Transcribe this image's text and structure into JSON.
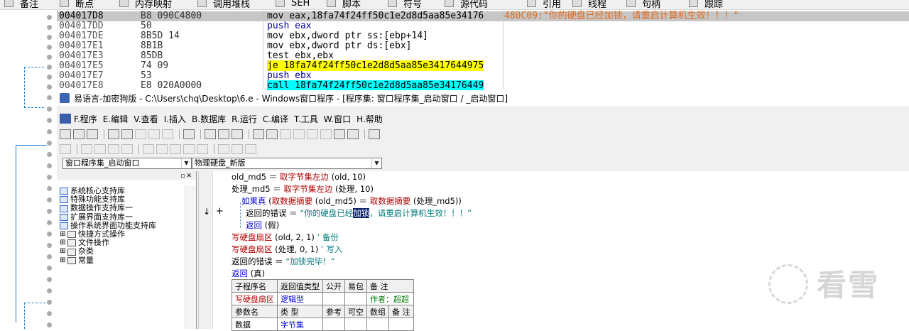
{
  "toolbar": {
    "items": [
      "备注",
      "断点",
      "内存映射",
      "调用堆栈",
      "SEH",
      "脚本",
      "符号",
      "源代码",
      "引用",
      "线程",
      "句柄",
      "跟踪"
    ]
  },
  "disasm": {
    "rows": [
      {
        "addr": "004017D8",
        "bytes": "B8 090C4800",
        "instr": "mov eax,18fa74f24ff50c1e2d8d5aa85e34176",
        "comment": "480C09:\"你的硬盘已经加锁，请重启计算机生效！！！\""
      },
      {
        "addr": "004017DD",
        "bytes": "50",
        "instr": "push eax",
        "comment": ""
      },
      {
        "addr": "004017DE",
        "bytes": "8B5D 14",
        "instr": "mov ebx,dword ptr ss:[ebp+14]",
        "comment": ""
      },
      {
        "addr": "004017E1",
        "bytes": "8B1B",
        "instr": "mov ebx,dword ptr ds:[ebx]",
        "comment": ""
      },
      {
        "addr": "004017E3",
        "bytes": "85DB",
        "instr": "test ebx,ebx",
        "comment": ""
      },
      {
        "addr": "004017E5",
        "bytes": "74 09",
        "instr": "je 18fa74f24ff50c1e2d8d5aa85e3417644975",
        "comment": ""
      },
      {
        "addr": "004017E7",
        "bytes": "53",
        "instr": "push ebx",
        "comment": ""
      },
      {
        "addr": "004017E8",
        "bytes": "E8 020A0000",
        "instr": "call 18fa74f24ff50c1e2d8d5aa85e34176449",
        "comment": ""
      }
    ]
  },
  "window": {
    "title": "易语言-加密狗版 - C:\\Users\\chq\\Desktop\\6.e - Windows窗口程序 - [程序集: 窗口程序集_启动窗口 / _启动窗口]"
  },
  "menu": {
    "items": [
      "F.程序",
      "E.编辑",
      "V.查看",
      "I.插入",
      "B.数据库",
      "R.运行",
      "C.编译",
      "T.工具",
      "W.窗口",
      "H.帮助"
    ]
  },
  "combos": {
    "assembly": "窗口程序集_启动窗口",
    "subroutine": "物理硬盘_新版"
  },
  "tree": [
    {
      "label": "系统核心支持库",
      "kind": "book"
    },
    {
      "label": "特殊功能支持库",
      "kind": "book"
    },
    {
      "label": "数据操作支持库一",
      "kind": "book"
    },
    {
      "label": "扩展界面支持库一",
      "kind": "book"
    },
    {
      "label": "操作系统界面功能支持库",
      "kind": "book"
    },
    {
      "label": "快捷方式操作",
      "kind": "plus"
    },
    {
      "label": "文件操作",
      "kind": "plus"
    },
    {
      "label": "杂类",
      "kind": "plus"
    },
    {
      "label": "常量",
      "kind": "plus"
    }
  ],
  "code": {
    "l1a": "old_md5 ＝ ",
    "l1b": "取字节集左边",
    "l1c": " (old, 10)",
    "l2a": "处理_md5 ＝ ",
    "l2b": "取字节集左边",
    "l2c": " (处理, 10)",
    "l3a": "如果真",
    "l3b": " (",
    "l3c": "取数据摘要",
    "l3d": " (old_md5) ＝ ",
    "l3e": "取数据摘要",
    "l3f": " (处理_md5))",
    "l4a": "返回的错误 ＝ ",
    "l4b": "“你的硬盘已经",
    "l4c": "加锁",
    "l4d": "，请重启计算机生效！！！”",
    "l5a": "返回",
    "l5b": " (假)",
    "l6a": "写硬盘扇区",
    "l6b": " (old, 2, 1) ",
    "l6c": "’ 备份",
    "l7a": "写硬盘扇区",
    "l7b": " (处理, 0, 1) ",
    "l7c": "’ 写入",
    "l8a": "返回的错误 ＝ ",
    "l8b": "“加锁完毕！”",
    "l9a": "返回",
    "l9b": " (真)"
  },
  "subtable": {
    "h1": [
      "子程序名",
      "返回值类型",
      "公开",
      "易包",
      "备 注"
    ],
    "r1": [
      "写硬盘扇区",
      "逻辑型",
      "",
      "",
      "作者：超超"
    ],
    "h2": [
      "参数名",
      "类 型",
      "参考",
      "可空",
      "数组",
      "备 注"
    ],
    "r2": [
      "数据",
      "字节集",
      "",
      "",
      "",
      ""
    ]
  },
  "watermark": "看雪",
  "colors": {
    "highlight": "#ffff00",
    "cyan": "#00ffff",
    "comment": "#e06a1a",
    "selection": "#c6c6c6"
  }
}
